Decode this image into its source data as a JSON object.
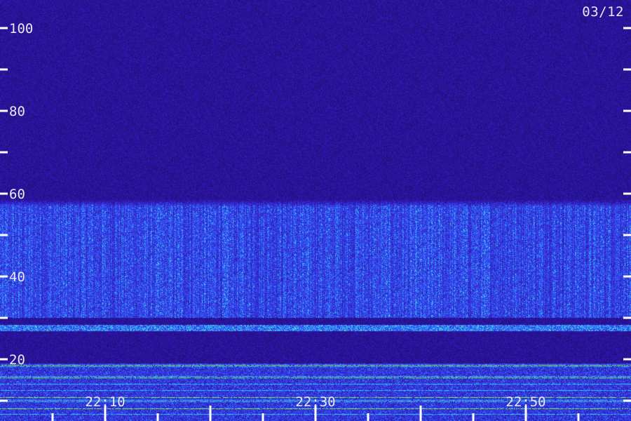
{
  "date_label": "03/12",
  "chart_data": {
    "type": "heatmap",
    "title": "",
    "xlabel": "",
    "ylabel": "",
    "ylim": [
      0,
      110
    ],
    "y_ticks": [
      20,
      40,
      60,
      80,
      100
    ],
    "y_minor_ticks": [
      0,
      10,
      30,
      50,
      70,
      90
    ],
    "x_ticks": [
      "22:10",
      "22:30",
      "22:50"
    ],
    "x_tick_minutes": [
      10,
      30,
      50
    ],
    "x_range_minutes": [
      0,
      60
    ],
    "colors": {
      "background": "#1a0a55",
      "low": "#2b16a8",
      "mid": "#3a4cff",
      "band": "#36d6ff",
      "hot": "#7dff5a",
      "text": "#e8e8f0"
    },
    "bands": [
      {
        "name": "emission band",
        "low": 30,
        "high": 57,
        "intensity": 0.55
      },
      {
        "name": "narrow line",
        "low": 26.8,
        "high": 28.4,
        "intensity": 1.0
      },
      {
        "name": "low-frequency lines",
        "low": 0,
        "high": 19,
        "intensity": 0.9
      }
    ]
  }
}
